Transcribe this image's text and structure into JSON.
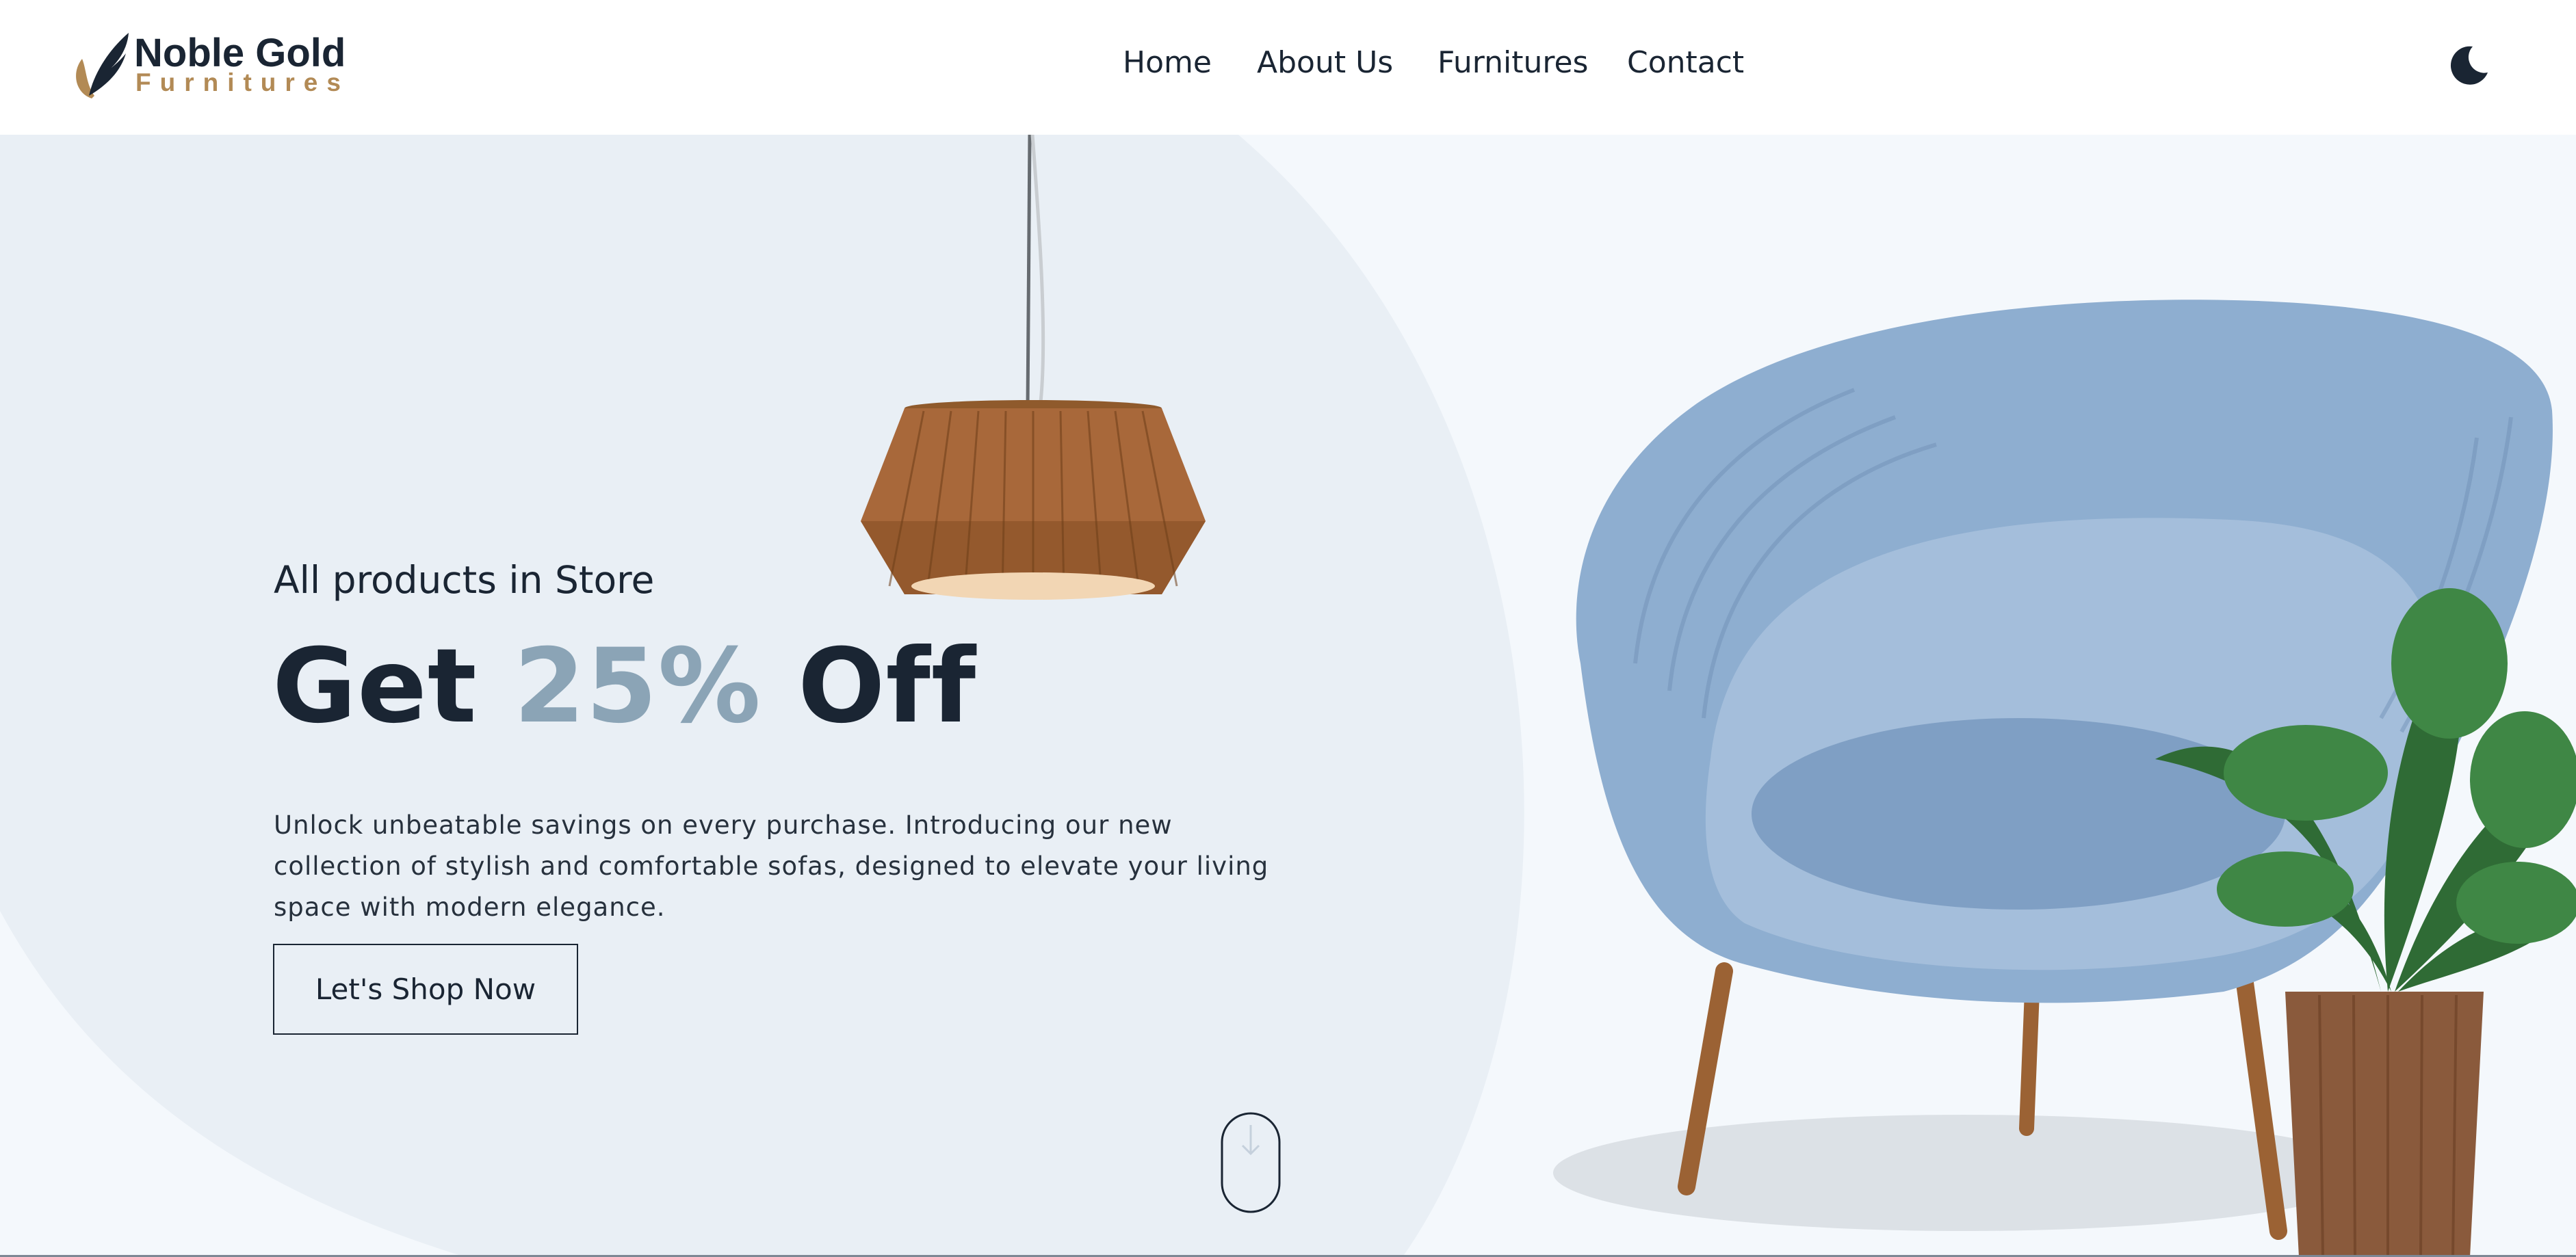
{
  "header": {
    "logo": {
      "title": "Noble Gold",
      "subtitle": "Furnitures"
    },
    "nav": [
      {
        "label": "Home"
      },
      {
        "label": "About Us"
      },
      {
        "label": "Furnitures"
      },
      {
        "label": "Contact"
      }
    ],
    "theme_toggle_icon": "moon-icon"
  },
  "hero": {
    "subtitle": "All products in Store",
    "headline_prefix": "Get ",
    "headline_accent": "25%",
    "headline_suffix": " Off",
    "description": "Unlock unbeatable savings on every purchase. Introducing our new collection of stylish and comfortable sofas, designed to elevate your living space with modern elegance.",
    "cta_label": "Let's Shop Now",
    "scroll_icon": "arrow-down-icon",
    "images": [
      "pendant-lamp",
      "armchair-with-plant"
    ]
  },
  "colors": {
    "text_dark": "#1a2533",
    "accent_blue_gray": "#8ba4b6",
    "logo_gold": "#b28a55",
    "hero_shape": "#e9eff5",
    "page_bg": "#f4f8fc"
  }
}
